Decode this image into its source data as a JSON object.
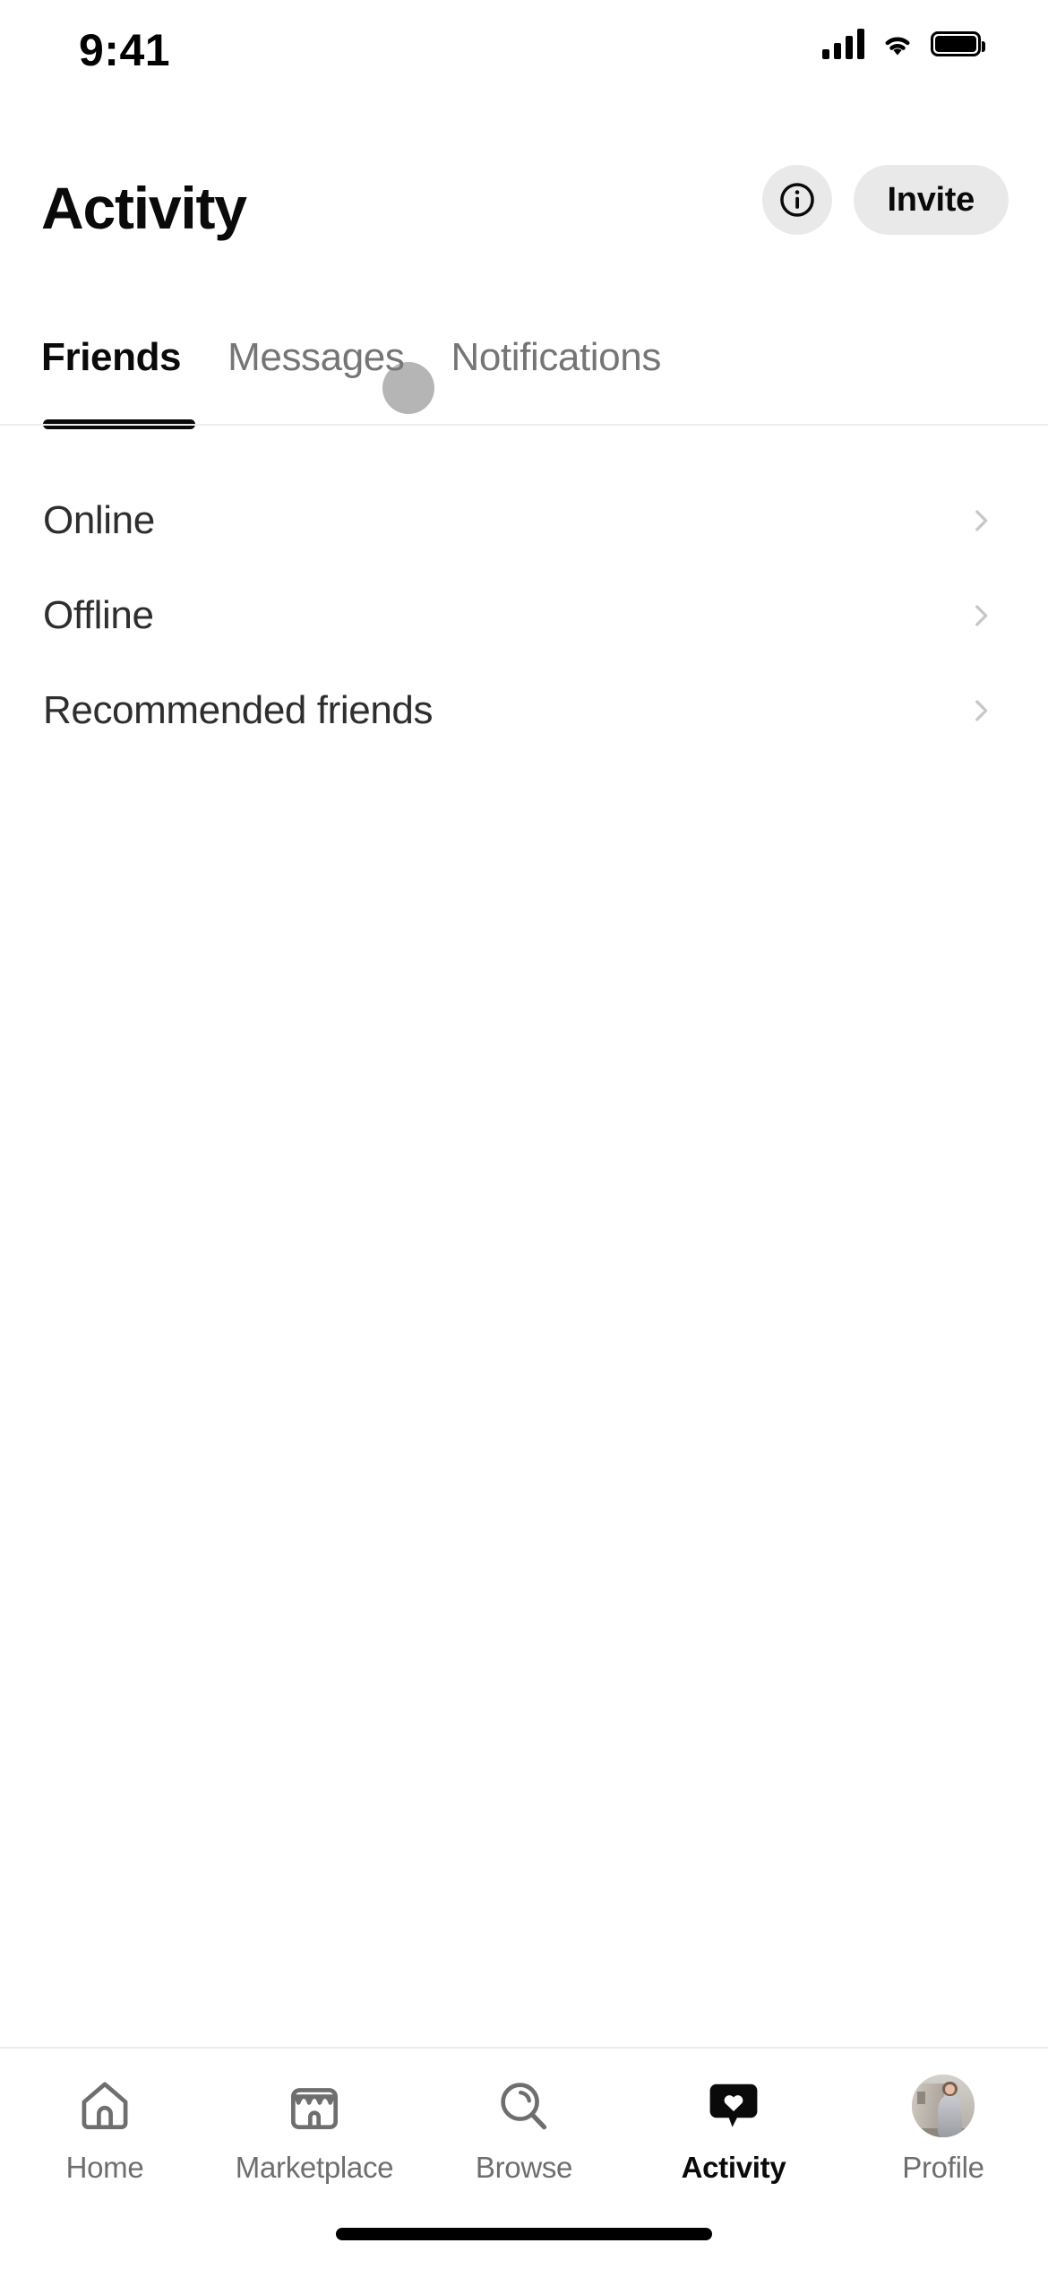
{
  "status_bar": {
    "time": "9:41",
    "signal_icon": "cellular-signal-icon",
    "wifi_icon": "wifi-icon",
    "battery_icon": "battery-icon"
  },
  "header": {
    "title": "Activity",
    "info_button_label": "i",
    "info_icon": "info-circle-icon",
    "invite_label": "Invite"
  },
  "tabs": {
    "items": [
      {
        "label": "Friends",
        "active": true
      },
      {
        "label": "Messages",
        "active": false
      },
      {
        "label": "Notifications",
        "active": false
      }
    ],
    "active_index": 0
  },
  "list": {
    "rows": [
      {
        "label": "Online",
        "chevron": "chevron-right-icon"
      },
      {
        "label": "Offline",
        "chevron": "chevron-right-icon"
      },
      {
        "label": "Recommended friends",
        "chevron": "chevron-right-icon"
      }
    ]
  },
  "bottom_nav": {
    "items": [
      {
        "label": "Home",
        "icon": "home-icon",
        "active": false
      },
      {
        "label": "Marketplace",
        "icon": "storefront-icon",
        "active": false
      },
      {
        "label": "Browse",
        "icon": "search-magnifier-icon",
        "active": false
      },
      {
        "label": "Activity",
        "icon": "heart-speech-bubble-icon",
        "active": true
      },
      {
        "label": "Profile",
        "icon": "avatar-photo-icon",
        "active": false
      }
    ]
  },
  "colors": {
    "background": "#ffffff",
    "text_primary": "#0a0a0a",
    "text_secondary": "#757575",
    "row_text": "#2e2e2e",
    "button_bg": "#e9e9ea",
    "chevron": "#c7c7c7",
    "divider": "#ededed",
    "accent_active": "#000000"
  }
}
